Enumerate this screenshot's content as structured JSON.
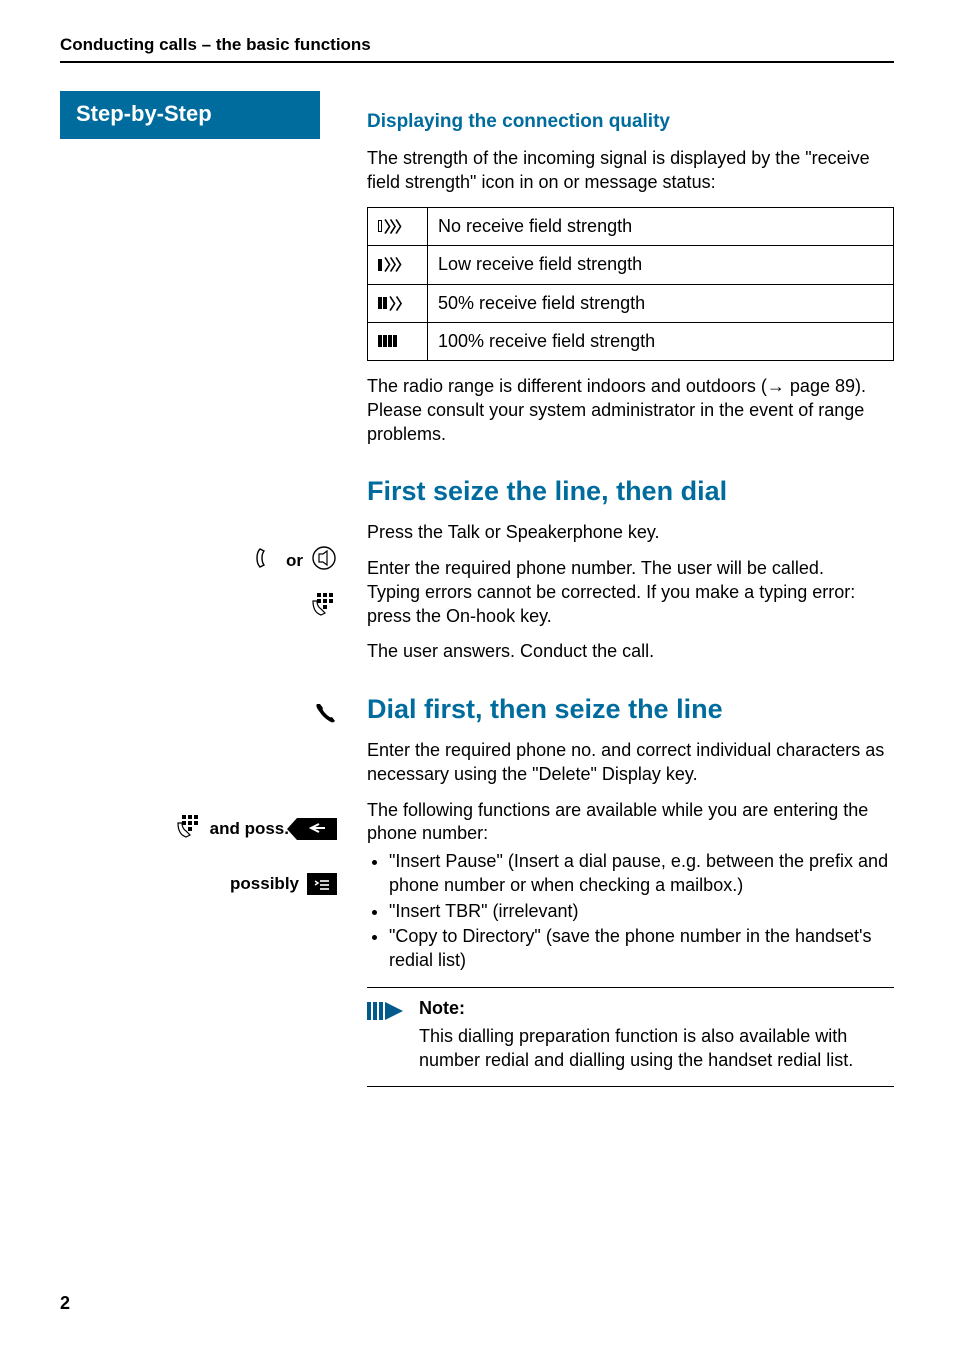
{
  "running_head": "Conducting calls – the basic functions",
  "step_badge": "Step-by-Step",
  "sec1": {
    "heading": "Displaying the connection quality",
    "intro": "The strength of the incoming signal is displayed by the \"receive field strength\" icon in on or message status:",
    "rows": [
      {
        "icon": "signal-0",
        "label": "No receive field strength"
      },
      {
        "icon": "signal-1",
        "label": "Low receive field strength"
      },
      {
        "icon": "signal-2",
        "label": "50% receive field strength"
      },
      {
        "icon": "signal-3",
        "label": "100% receive field strength"
      }
    ],
    "range_text_a": "The radio range is different indoors and outdoors (",
    "range_link": "→ page 89",
    "range_text_b": "). Please consult your system administrator in the event of range problems."
  },
  "sec2": {
    "heading": "First seize the line, then dial",
    "left1_or": "or",
    "step1": "Press the Talk or Speakerphone key.",
    "step2": "Enter the required phone number. The user will be called.\nTyping errors cannot be corrected. If you make a typing error: press the On-hook key.",
    "step3": "The user answers. Conduct the call."
  },
  "sec3": {
    "heading": "Dial first, then seize the line",
    "left1_and": "and poss.",
    "step1": "Enter the required phone no. and correct individual characters as necessary using the \"Delete\" Display key.",
    "left2": "possibly",
    "step2_intro": "The following functions are available while you are entering the phone number:",
    "funcs": [
      "\"Insert Pause\" (Insert a dial pause, e.g.  between the prefix and phone number or when checking a mailbox.)",
      "\"Insert TBR\" (irrelevant)",
      "\"Copy to Directory\" (save the phone number in the handset's redial list)"
    ],
    "note_title": "Note:",
    "note_body": "This dialling preparation function is also available with number redial and dialling using the handset redial list."
  },
  "pagenum": "2"
}
